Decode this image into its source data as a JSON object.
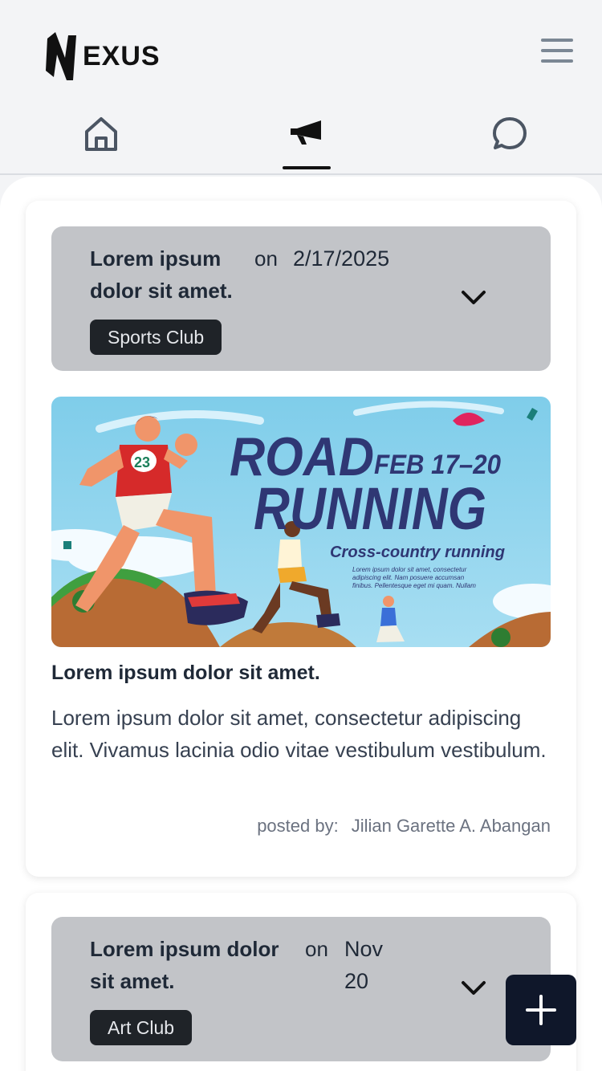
{
  "app": {
    "logo_text": "EXUS"
  },
  "tabs": [
    {
      "icon": "home-icon",
      "active": false
    },
    {
      "icon": "megaphone-icon",
      "active": true
    },
    {
      "icon": "chat-icon",
      "active": false
    }
  ],
  "posts": [
    {
      "header_title": "Lorem ipsum dolor sit amet.",
      "on_label": "on",
      "date": "2/17/2025",
      "tag": "Sports Club",
      "banner": {
        "title_line1": "ROAD",
        "title_line2": "RUNNING",
        "date": "FEB 17–20",
        "subtitle": "Cross-country running",
        "blurb_line1": "Lorem ipsum dolor sit amet, consectetur",
        "blurb_line2": "adipiscing elit. Nam posuere accumsan",
        "blurb_line3": "finibus. Pellentesque eget mi quam. Nullam",
        "runner_number": "23"
      },
      "title": "Lorem ipsum dolor sit amet.",
      "body": "Lorem ipsum dolor sit amet, consectetur adipiscing elit. Vivamus lacinia odio vitae vestibulum vestibulum.",
      "posted_by_label": "posted by:",
      "author": "Jilian Garette A. Abangan"
    },
    {
      "header_title": "Lorem ipsum dolor sit amet.",
      "on_label": "on",
      "date_line1": "Nov",
      "date_line2": "20",
      "tag": "Art Club"
    }
  ],
  "colors": {
    "accent_dark": "#0f172a",
    "header_bg": "#c2c4c8",
    "page_bg": "#f3f4f6"
  }
}
